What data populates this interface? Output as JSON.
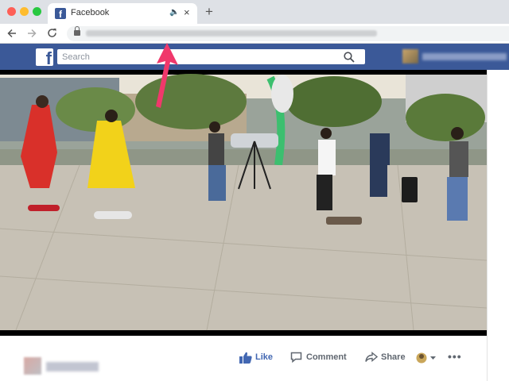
{
  "browser": {
    "tab_title": "Facebook",
    "new_tab_symbol": "+",
    "close_symbol": "×",
    "audio_symbol": "🔈"
  },
  "facebook": {
    "logo_letter": "f",
    "search_placeholder": "Search"
  },
  "post_actions": {
    "like": "Like",
    "comment": "Comment",
    "share": "Share",
    "more": "•••"
  },
  "colors": {
    "fb_blue": "#3b5998",
    "like_blue": "#4267b2",
    "annotation_arrow": "#f0386b"
  },
  "icons": [
    "search-icon",
    "back-arrow-icon",
    "forward-arrow-icon",
    "reload-icon",
    "lock-icon",
    "like-thumb-icon",
    "comment-bubble-icon",
    "share-arrow-icon",
    "reaction-icon",
    "annotation-arrow"
  ]
}
